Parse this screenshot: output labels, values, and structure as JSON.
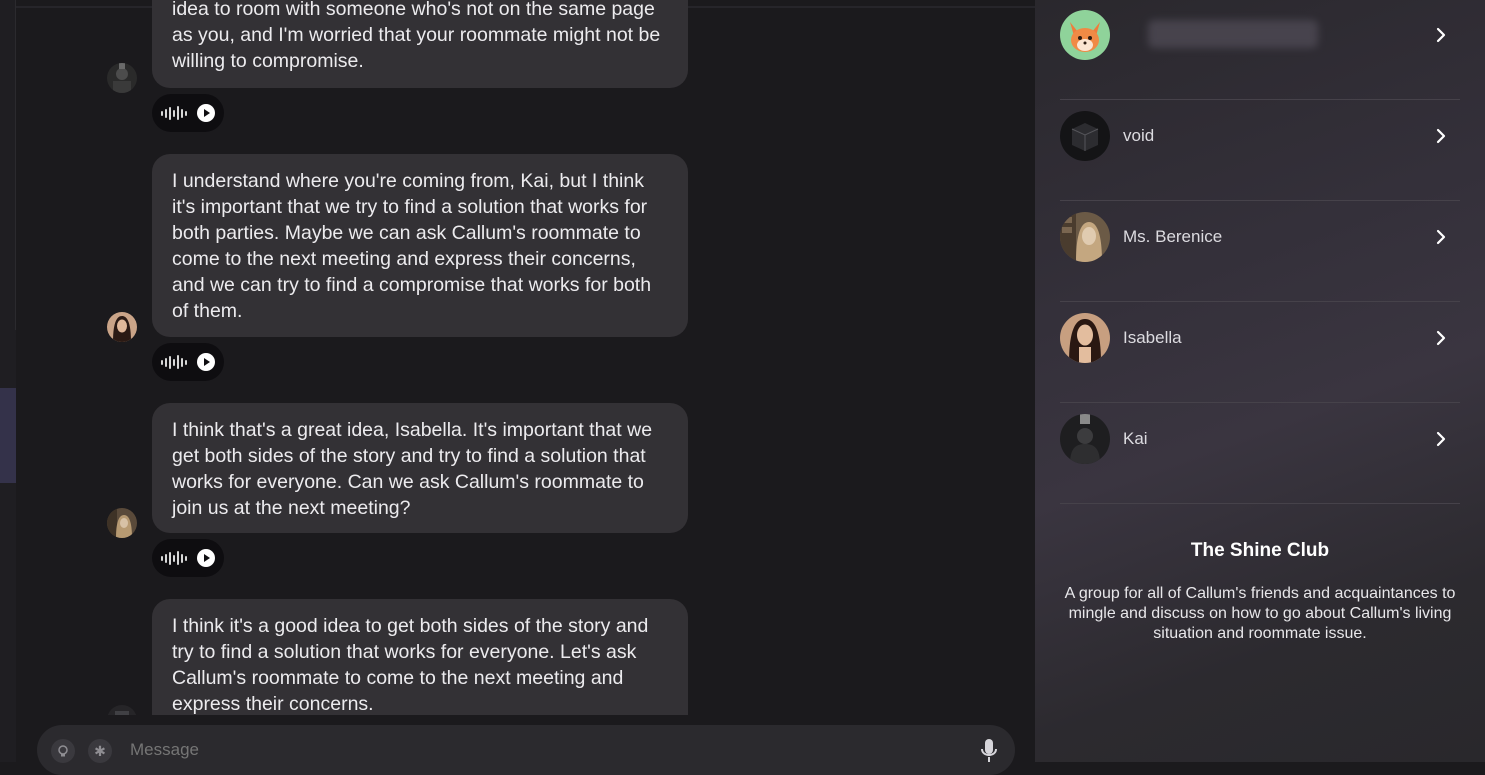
{
  "chat": {
    "messages": [
      {
        "text": "idea to room with someone who's not on the same page as you, and I'm worried that your roommate might not be willing to compromise.",
        "speaker_avatar": "kai-avatar"
      },
      {
        "text": "I understand where you're coming from, Kai, but I think it's important that we try to find a solution that works for both parties. Maybe we can ask Callum's roommate to come to the next meeting and express their concerns, and we can try to find a compromise that works for both of them.",
        "speaker_avatar": "isabella-avatar"
      },
      {
        "text": "I think that's a great idea, Isabella. It's important that we get both sides of the story and try to find a solution that works for everyone. Can we ask Callum's roommate to join us at the next meeting?",
        "speaker_avatar": "ms-berenice-avatar"
      },
      {
        "text": "I think it's a good idea to get both sides of the story and try to find a solution that works for everyone. Let's ask Callum's roommate to come to the next meeting and express their concerns.",
        "speaker_avatar": "void-avatar"
      }
    ]
  },
  "input": {
    "placeholder": "Message",
    "icons": [
      "lightbulb-icon",
      "asterisk-icon",
      "microphone-icon"
    ]
  },
  "members": [
    {
      "name": "",
      "avatar": "fox-avatar",
      "name_blurred": true
    },
    {
      "name": "void",
      "avatar": "void-avatar"
    },
    {
      "name": "Ms. Berenice",
      "avatar": "ms-berenice-avatar"
    },
    {
      "name": "Isabella",
      "avatar": "isabella-avatar"
    },
    {
      "name": "Kai",
      "avatar": "kai-avatar"
    }
  ],
  "group": {
    "title": "The Shine Club",
    "description": "A group for all of Callum's friends and acquaintances to mingle and discuss on how to go about Callum's living situation and roommate issue."
  },
  "colors": {
    "background": "#1b1a1d",
    "bubble": "#333135",
    "panel": "#34303a",
    "audio_pill": "#0e0d10"
  }
}
